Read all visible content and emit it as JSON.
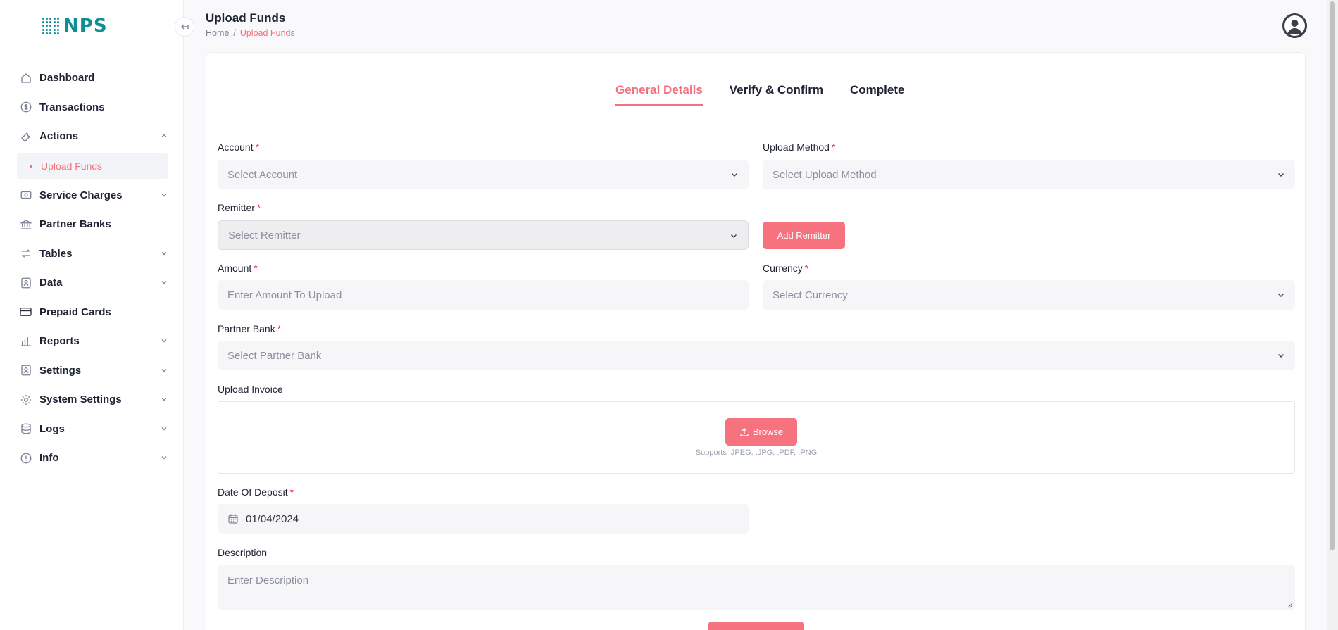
{
  "app": {
    "logo_text": "NPS"
  },
  "sidebar": {
    "items": [
      {
        "label": "Dashboard"
      },
      {
        "label": "Transactions"
      },
      {
        "label": "Actions"
      },
      {
        "label": "Upload Funds"
      },
      {
        "label": "Service Charges"
      },
      {
        "label": "Partner Banks"
      },
      {
        "label": "Tables"
      },
      {
        "label": "Data"
      },
      {
        "label": "Prepaid Cards"
      },
      {
        "label": "Reports"
      },
      {
        "label": "Settings"
      },
      {
        "label": "System Settings"
      },
      {
        "label": "Logs"
      },
      {
        "label": "Info"
      }
    ]
  },
  "header": {
    "title": "Upload Funds",
    "breadcrumb": {
      "home": "Home",
      "separator": "/",
      "current": "Upload Funds"
    }
  },
  "tabs": [
    {
      "label": "General Details",
      "active": true
    },
    {
      "label": "Verify & Confirm",
      "active": false
    },
    {
      "label": "Complete",
      "active": false
    }
  ],
  "form": {
    "account": {
      "label": "Account",
      "required": "*",
      "placeholder": "Select Account"
    },
    "upload_method": {
      "label": "Upload Method",
      "required": "*",
      "placeholder": "Select Upload Method"
    },
    "remitter": {
      "label": "Remitter",
      "required": "*",
      "placeholder": "Select Remitter"
    },
    "add_remitter_label": "Add Remitter",
    "amount": {
      "label": "Amount",
      "required": "*",
      "placeholder": "Enter Amount To Upload"
    },
    "currency": {
      "label": "Currency",
      "required": "*",
      "placeholder": "Select Currency"
    },
    "partner_bank": {
      "label": "Partner Bank",
      "required": "*",
      "placeholder": "Select Partner Bank"
    },
    "upload_invoice": {
      "label": "Upload Invoice",
      "browse_label": "Browse",
      "supports_text": "Supports .JPEG, .JPG, .PDF, .PNG"
    },
    "date_of_deposit": {
      "label": "Date Of Deposit",
      "required": "*",
      "value": "01/04/2024"
    },
    "description": {
      "label": "Description",
      "placeholder": "Enter Description"
    }
  },
  "colors": {
    "accent": "#f6727f",
    "brand": "#0e8f95",
    "text": "#1e2233",
    "muted": "#8b90a0"
  }
}
